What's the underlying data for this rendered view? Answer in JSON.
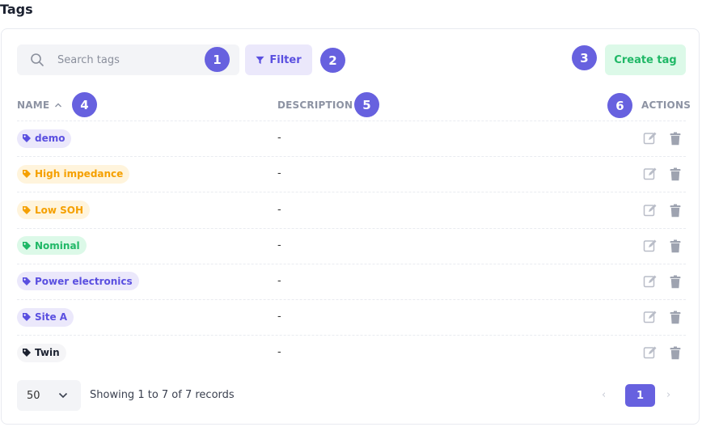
{
  "page": {
    "title": "Tags"
  },
  "toolbar": {
    "search_placeholder": "Search tags",
    "filter_label": "Filter",
    "create_label": "Create tag"
  },
  "annotations": [
    "1",
    "2",
    "3",
    "4",
    "5",
    "6"
  ],
  "table": {
    "columns": {
      "name": "NAME",
      "description": "DESCRIPTION",
      "actions": "ACTIONS"
    },
    "rows": [
      {
        "name": "demo",
        "description": "-",
        "bg": "#ebe8fb",
        "fg": "#5a4fe0"
      },
      {
        "name": "High impedance",
        "description": "-",
        "bg": "#fff4dc",
        "fg": "#f5a000"
      },
      {
        "name": "Low SOH",
        "description": "-",
        "bg": "#fff4dc",
        "fg": "#f5a000"
      },
      {
        "name": "Nominal",
        "description": "-",
        "bg": "#dcf9e8",
        "fg": "#1fb866"
      },
      {
        "name": "Power electronics",
        "description": "-",
        "bg": "#ebe8fb",
        "fg": "#5a4fe0"
      },
      {
        "name": "Site A",
        "description": "-",
        "bg": "#ebe8fb",
        "fg": "#5a4fe0"
      },
      {
        "name": "Twin",
        "description": "-",
        "bg": "#f5f5f7",
        "fg": "#1b2130"
      }
    ]
  },
  "footer": {
    "page_size": "50",
    "records_text": "Showing 1 to 7 of 7 records",
    "prev_label": "‹",
    "current_page": "1",
    "next_label": "›"
  },
  "colors": {
    "accent": "#6761df",
    "success": "#1fb866",
    "warning": "#f5a000"
  },
  "icons": {
    "search": "search-icon",
    "filter": "filter-icon",
    "sort": "chevron-up-icon",
    "tag": "tag-icon",
    "edit": "edit-icon",
    "delete": "trash-icon",
    "dropdown": "chevron-down-icon"
  }
}
